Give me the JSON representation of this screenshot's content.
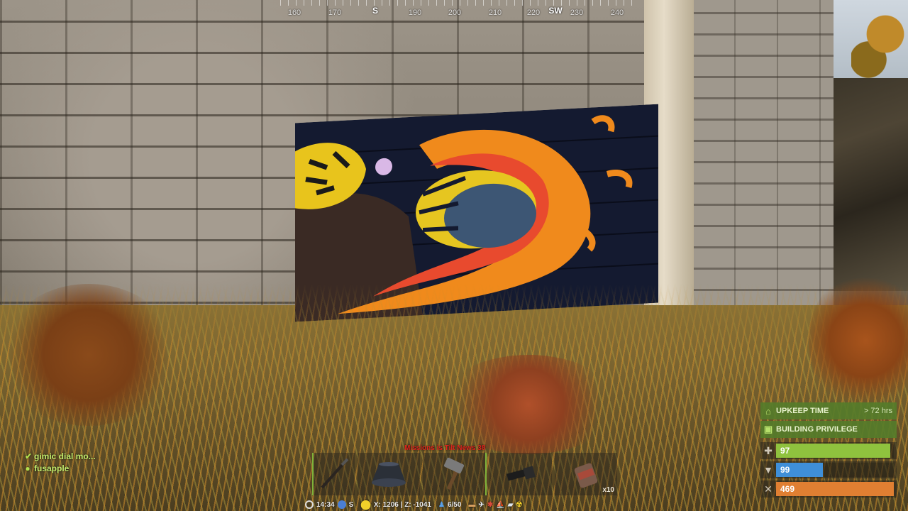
{
  "compass": {
    "degrees": [
      "160",
      "170",
      "190",
      "200",
      "210",
      "220",
      "230",
      "240"
    ],
    "cardinals": [
      "S",
      "SW"
    ]
  },
  "chat": {
    "lines": [
      {
        "mark": "✔",
        "text": "gimic dial mo..."
      },
      {
        "mark": "●",
        "text": "fusapple"
      }
    ]
  },
  "status": {
    "upkeep": {
      "icon": "house-icon",
      "label": "UPKEEP TIME",
      "value": "> 72 hrs"
    },
    "privilege": {
      "icon": "cube-icon",
      "label": "BUILDING PRIVILEGE"
    }
  },
  "vitals": {
    "health": {
      "icon": "plus-icon",
      "value": "97",
      "level": 0.97,
      "color": "#8fc23e"
    },
    "hydration": {
      "icon": "cup-icon",
      "value": "99",
      "level": 0.4,
      "color": "#3f8fd8"
    },
    "food": {
      "icon": "fork-knife-icon",
      "value": "469",
      "level": 1.0,
      "color": "#e07f32"
    }
  },
  "hotbar": {
    "warning": "Missions is Tilt News 38",
    "slots": [
      {
        "icon": "spear-icon",
        "count": ""
      },
      {
        "icon": "bowl-icon",
        "count": ""
      },
      {
        "icon": "hammer-icon",
        "count": ""
      },
      {
        "icon": "flashlight-icon",
        "count": ""
      },
      {
        "icon": "tin-can-icon",
        "count": "x10"
      }
    ]
  },
  "infobar": {
    "time": "14:34",
    "coords": "X: 1206 | Z: -1041",
    "players": "6/50",
    "direction": "S"
  },
  "colors": {
    "status_green": "#547c2a",
    "accent_green": "#7fb23a",
    "chat_green": "#c6ef6e"
  }
}
